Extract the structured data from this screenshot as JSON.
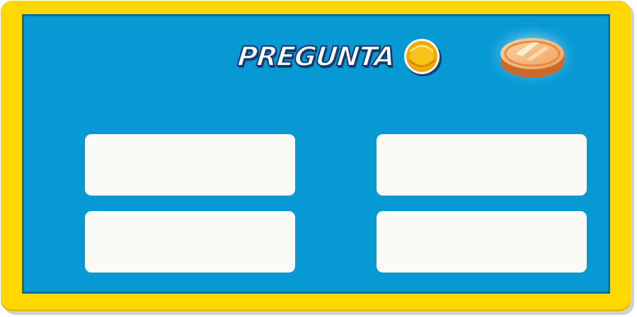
{
  "header": {
    "title": "PREGUNTA"
  },
  "icons": {
    "title_coin": "coin-icon",
    "reward_coin": "glowing-coin-icon"
  },
  "answers": [
    {
      "label": ""
    },
    {
      "label": ""
    },
    {
      "label": ""
    },
    {
      "label": ""
    }
  ],
  "colors": {
    "frame": "#ffd800",
    "board": "#0699d4",
    "board_border": "#0b6e9c",
    "answer_background": "#fafaf6",
    "title_outline": "#173a6e",
    "coin": "#f2a800"
  }
}
